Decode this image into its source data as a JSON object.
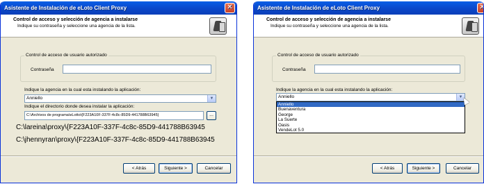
{
  "window_title": "Asistente de Instalación de eLoto Client Proxy",
  "header": {
    "title": "Control de acceso y selección de agencia a instalarse",
    "subtitle": "Indique su contraseña y seleccione una agencia de la lista."
  },
  "auth_group": {
    "legend": "Control de acceso de usuario autorizado",
    "password_label": "Contraseña",
    "password_value": ""
  },
  "agency_label": "Indique la agencia en la cual esta instalando la aplicación:",
  "agency_selected": "Anniello",
  "dir_label": "Indique el directorio donde desea instalar la aplicación:",
  "dir_value": "C:\\Archivos de programa\\eLotto\\{F223A10F-337F-4c8c-85D9-441788B63945}",
  "browse_label": "...",
  "overlay_paths": [
    "C:\\lareina\\proxy\\{F223A10F-337F-4c8c-85D9-441788B63945",
    "C:\\jhennyran\\proxy\\{F223A10F-337F-4c8c-85D9-441788B63945"
  ],
  "buttons": {
    "back": "< Atrás",
    "next": "Siguiente >",
    "cancel": "Cancelar"
  },
  "close_glyph": "✕",
  "agency_options": [
    "Anniello",
    "Buenaventura",
    "George",
    "La Suerte",
    "Oasis",
    "VendeLot 5.0"
  ],
  "colors": {
    "titlebar": "#0b47c9",
    "dialog_bg": "#ece9d8",
    "selection": "#316ac5",
    "close": "#c8422a"
  },
  "icons": [
    "close-icon",
    "wizard-icon",
    "dropdown-arrow-icon",
    "mouse-cursor-icon"
  ]
}
